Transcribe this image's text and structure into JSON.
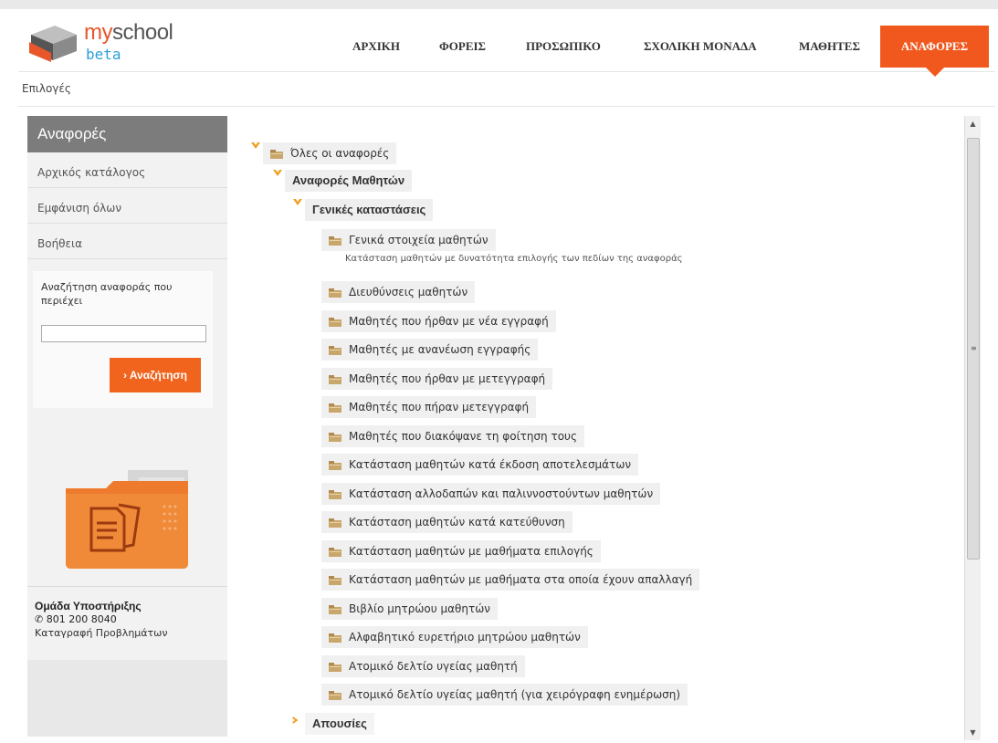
{
  "header": {
    "logo": {
      "my": "my",
      "school": "school",
      "beta": "beta"
    },
    "nav": [
      {
        "label": "ΑΡΧΙΚΗ",
        "active": false
      },
      {
        "label": "ΦΟΡΕΙΣ",
        "active": false
      },
      {
        "label": "ΠΡΟΣΩΠΙΚΟ",
        "active": false
      },
      {
        "label": "ΣΧΟΛΙΚΗ ΜΟΝΑΔΑ",
        "active": false
      },
      {
        "label": "ΜΑΘΗΤΕΣ",
        "active": false
      },
      {
        "label": "ΑΝΑΦΟΡΕΣ",
        "active": true
      }
    ],
    "accent_color": "#f0581e"
  },
  "subbar": {
    "label": "Επιλογές"
  },
  "sidebar": {
    "title": "Αναφορές",
    "items": [
      {
        "label": "Αρχικός κατάλογος"
      },
      {
        "label": "Εμφάνιση όλων"
      },
      {
        "label": "Βοήθεια"
      }
    ],
    "search": {
      "label": "Αναζήτηση αναφοράς που περιέχει",
      "value": "",
      "button": "› Αναζήτηση"
    },
    "support": {
      "title": "Ομάδα Υποστήριξης",
      "phone": "801 200 8040",
      "link": "Καταγραφή Προβλημάτων"
    }
  },
  "tree": {
    "root": "Όλες οι αναφορές",
    "group": "Αναφορές Μαθητών",
    "subgroup": "Γενικές καταστάσεις",
    "first_report": {
      "label": "Γενικά στοιχεία μαθητών",
      "description": "Κατάσταση μαθητών με δυνατότητα επιλογής των πεδίων της αναφοράς"
    },
    "reports": [
      "Διευθύνσεις μαθητών",
      "Μαθητές που ήρθαν με νέα εγγραφή",
      "Μαθητές με ανανέωση εγγραφής",
      "Μαθητές που ήρθαν με μετεγγραφή",
      "Μαθητές που πήραν μετεγγραφή",
      "Μαθητές που διακόψανε τη φοίτηση τους",
      "Κατάσταση μαθητών κατά έκδοση αποτελεσμάτων",
      "Κατάσταση αλλοδαπών και παλιννοστούντων μαθητών",
      "Κατάσταση μαθητών κατά κατεύθυνση",
      "Κατάσταση μαθητών με μαθήματα επιλογής",
      "Κατάσταση μαθητών με μαθήματα στα οποία έχουν απαλλαγή",
      "Βιβλίο μητρώου μαθητών",
      "Αλφαβητικό ευρετήριο μητρώου μαθητών",
      "Ατομικό δελτίο υγείας μαθητή",
      "Ατομικό δελτίο υγείας μαθητή (για χειρόγραφη ενημέρωση)"
    ],
    "collapsed_group": "Απουσίες"
  },
  "icons": {
    "expanded": "chevron-down-icon",
    "collapsed": "chevron-right-icon",
    "report": "folder-icon",
    "phone": "phone-icon"
  }
}
